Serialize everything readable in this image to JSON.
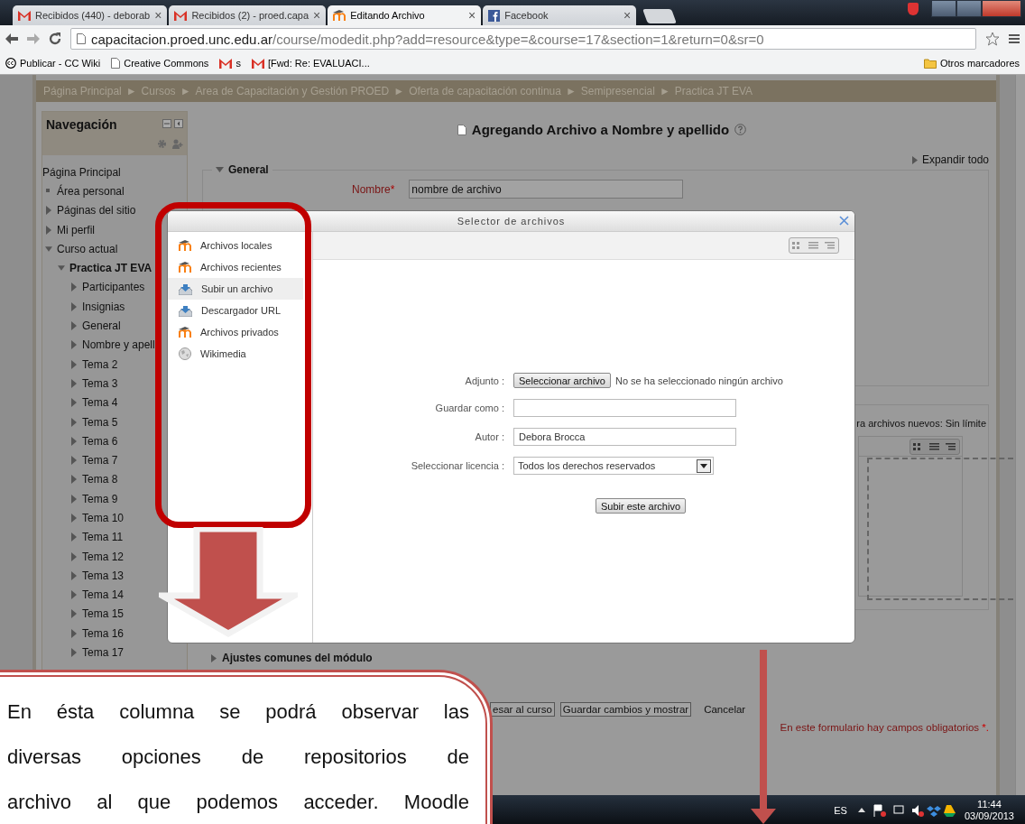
{
  "browser": {
    "tabs": [
      {
        "title": "Recibidos (440) - deborab",
        "kind": "gmail",
        "close": "×",
        "selected": false
      },
      {
        "title": "Recibidos (2) - proed.capa",
        "kind": "gmail",
        "close": "×",
        "selected": false
      },
      {
        "title": "Editando Archivo",
        "kind": "moodle",
        "close": "×",
        "selected": true
      },
      {
        "title": "Facebook",
        "kind": "facebook",
        "close": "×",
        "selected": false
      }
    ],
    "address": {
      "host": "capacitacion.proed.unc.edu.ar",
      "path": "/course/modedit.php?add=resource&type=&course=17&section=1&return=0&sr=0"
    },
    "bookmarks": [
      {
        "label": "Publicar - CC Wiki",
        "kind": "cc"
      },
      {
        "label": "Creative Commons",
        "kind": "page"
      },
      {
        "label": "s",
        "kind": "gmail"
      },
      {
        "label": "[Fwd: Re: EVALUACI...",
        "kind": "gmail"
      }
    ],
    "other_bookmarks": "Otros marcadores"
  },
  "breadcrumb": [
    {
      "label": "Página Principal"
    },
    {
      "sep": "►",
      "label": "Cursos"
    },
    {
      "sep": "►",
      "label": "Area de Capacitación y Gestión PROED"
    },
    {
      "sep": "►",
      "label": "Oferta de capacitación continua"
    },
    {
      "sep": "►",
      "label": "Semipresencial"
    },
    {
      "sep": "►",
      "label": "Practica JT EVA"
    }
  ],
  "navigation": {
    "title": "Navegación",
    "items": [
      {
        "label": "Página Principal",
        "kind": "home"
      },
      {
        "label": "Área personal",
        "kind": "bullet"
      },
      {
        "label": "Páginas del sitio",
        "kind": "branch",
        "expanded": false
      },
      {
        "label": "Mi perfil",
        "kind": "branch",
        "expanded": false
      },
      {
        "label": "Curso actual",
        "kind": "branch",
        "expanded": true,
        "children": [
          {
            "label": "Practica JT EVA",
            "kind": "course",
            "expanded": true,
            "children": [
              {
                "label": "Participantes",
                "kind": "branch",
                "expanded": false
              },
              {
                "label": "Insignias",
                "kind": "branch",
                "expanded": false
              },
              {
                "label": "General",
                "kind": "branch",
                "expanded": false
              },
              {
                "label": "Nombre y apell",
                "kind": "branch",
                "expanded": false
              },
              {
                "label": "Tema 2",
                "kind": "branch",
                "expanded": false
              },
              {
                "label": "Tema 3",
                "kind": "branch",
                "expanded": false
              },
              {
                "label": "Tema 4",
                "kind": "branch",
                "expanded": false
              },
              {
                "label": "Tema 5",
                "kind": "branch",
                "expanded": false
              },
              {
                "label": "Tema 6",
                "kind": "branch",
                "expanded": false
              },
              {
                "label": "Tema 7",
                "kind": "branch",
                "expanded": false
              },
              {
                "label": "Tema 8",
                "kind": "branch",
                "expanded": false
              },
              {
                "label": "Tema 9",
                "kind": "branch",
                "expanded": false
              },
              {
                "label": "Tema 10",
                "kind": "branch",
                "expanded": false
              },
              {
                "label": "Tema 11",
                "kind": "branch",
                "expanded": false
              },
              {
                "label": "Tema 12",
                "kind": "branch",
                "expanded": false
              },
              {
                "label": "Tema 13",
                "kind": "branch",
                "expanded": false
              },
              {
                "label": "Tema 14",
                "kind": "branch",
                "expanded": false
              },
              {
                "label": "Tema 15",
                "kind": "branch",
                "expanded": false
              },
              {
                "label": "Tema 16",
                "kind": "branch",
                "expanded": false
              },
              {
                "label": "Tema 17",
                "kind": "branch",
                "expanded": false
              }
            ]
          }
        ]
      }
    ]
  },
  "page": {
    "heading": "Agregando Archivo a Nombre y apellido",
    "expand_all": "Expandir todo",
    "general": {
      "legend": "General",
      "name_label": "Nombre",
      "required_mark": "*",
      "name_value": "nombre de archivo"
    },
    "file_limit": "ra archivos nuevos: Sin límite",
    "common_settings": "Ajustes comunes del módulo",
    "buttons": [
      "esar al curso",
      "Guardar cambios y mostrar"
    ],
    "cancel": "Cancelar",
    "required_note": "En este formulario hay campos obligatorios",
    "required_note_mark": "*."
  },
  "file_picker": {
    "title": "Selector de archivos",
    "repositories": [
      {
        "label": "Archivos locales",
        "kind": "moodle",
        "selected": false
      },
      {
        "label": "Archivos recientes",
        "kind": "moodle",
        "selected": false
      },
      {
        "label": "Subir un archivo",
        "kind": "upload",
        "selected": true
      },
      {
        "label": "Descargador URL",
        "kind": "upload",
        "selected": false
      },
      {
        "label": "Archivos privados",
        "kind": "moodle",
        "selected": false
      },
      {
        "label": "Wikimedia",
        "kind": "globe",
        "selected": false
      }
    ],
    "form": {
      "attach_label": "Adjunto :",
      "choose_button": "Seleccionar archivo",
      "no_file": "No se ha seleccionado ningún archivo",
      "save_as_label": "Guardar como :",
      "author_label": "Autor :",
      "author_value": "Debora Brocca",
      "license_label": "Seleccionar licencia :",
      "license_value": "Todos los derechos reservados",
      "upload_button": "Subir este archivo"
    }
  },
  "annotation": {
    "lines": [
      "En ésta columna se podrá observar las",
      "diversas opciones de repositorios de",
      "archivo al que podemos acceder. Moodle"
    ]
  },
  "taskbar": {
    "language": "ES",
    "time": "11:44",
    "date": "03/09/2013"
  }
}
